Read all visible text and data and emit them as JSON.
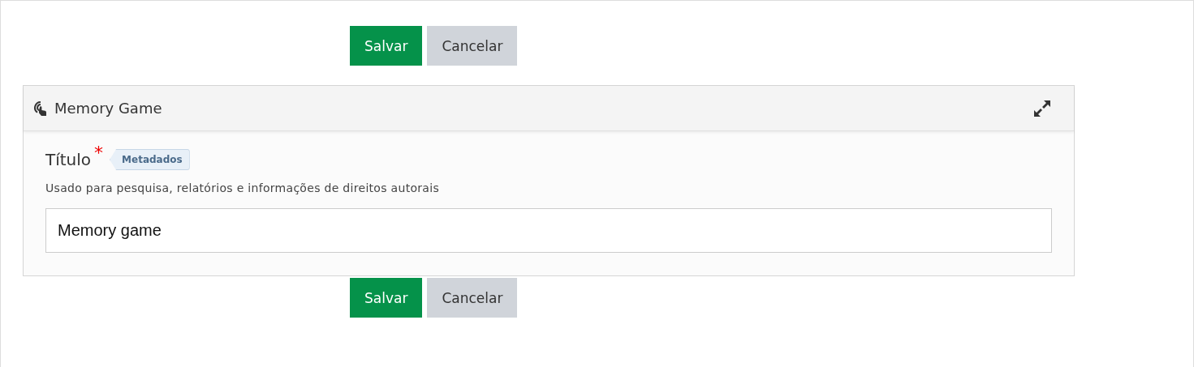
{
  "top_actions": [
    {
      "label": "Salvar",
      "kind": "primary"
    },
    {
      "label": "Cancelar",
      "kind": "secondary"
    }
  ],
  "panel": {
    "title": "Memory Game",
    "field": {
      "label": "Título",
      "required_mark": "*",
      "badge": "Metadados",
      "description": "Usado para pesquisa, relatórios e informações de direitos autorais",
      "value": "Memory game"
    }
  },
  "bottom_actions": [
    {
      "label": "Salvar",
      "kind": "primary"
    },
    {
      "label": "Cancelar",
      "kind": "secondary"
    }
  ]
}
